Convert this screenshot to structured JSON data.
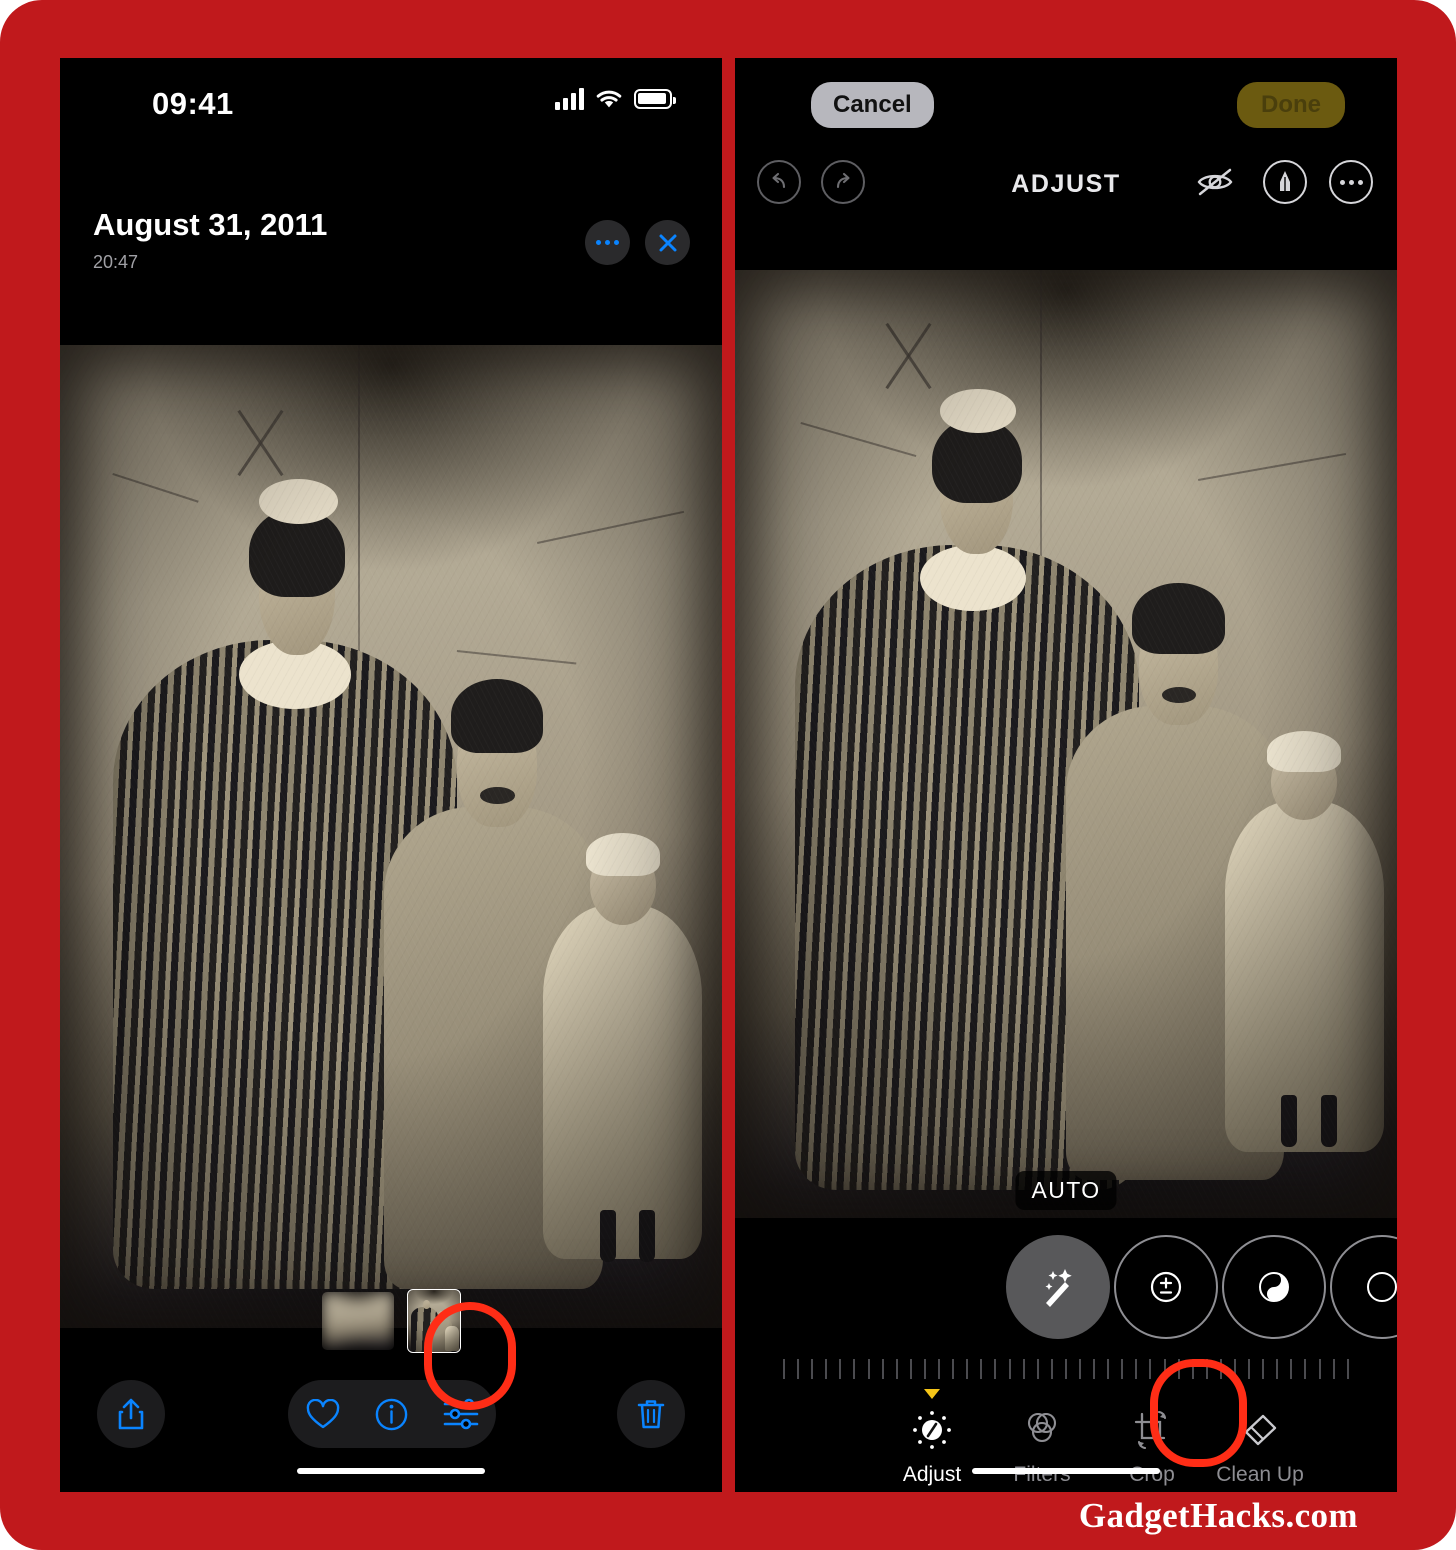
{
  "poster": {
    "background_color": "#c0191c",
    "watermark": "GadgetHacks.com"
  },
  "left_phone": {
    "status_bar": {
      "time": "09:41",
      "cellular_icon": "cellular-signal-icon",
      "wifi_icon": "wifi-icon",
      "battery_icon": "battery-full-icon"
    },
    "header": {
      "date": "August 31, 2011",
      "time": "20:47",
      "more_icon": "ellipsis-icon",
      "close_icon": "close-x-icon",
      "accent_color": "#0a84ff"
    },
    "photo": {
      "description": "Vintage sepia tintype family portrait",
      "alt": "Woman in striped dress standing beside seated man holding a small child"
    },
    "thumbnails": [
      {
        "name": "blurred-thumbnail",
        "selected": false
      },
      {
        "name": "portrait-thumbnail",
        "selected": true
      }
    ],
    "action_bar": {
      "share_label": "Share",
      "share_icon": "share-up-arrow-icon",
      "favorite_label": "Favorite",
      "favorite_icon": "heart-icon",
      "info_label": "Info",
      "info_icon": "info-circle-icon",
      "edit_label": "Edit",
      "edit_icon": "sliders-adjust-icon",
      "delete_label": "Delete",
      "delete_icon": "trash-icon"
    },
    "highlight": {
      "target": "sliders-adjust-icon",
      "color": "#ff2d16"
    }
  },
  "right_phone": {
    "top_bar": {
      "cancel_label": "Cancel",
      "done_label": "Done",
      "cancel_color": "#b7b7bd",
      "done_color": "#6b5a10"
    },
    "edit_bar": {
      "title": "ADJUST",
      "undo_icon": "undo-arrow-icon",
      "redo_icon": "redo-arrow-icon",
      "hide_icon": "eye-slash-icon",
      "markup_icon": "markup-pen-icon",
      "more_icon": "ellipsis-circle-icon"
    },
    "photo": {
      "description": "Vintage sepia tintype family portrait in editor",
      "auto_badge": "AUTO"
    },
    "adjust_tools": [
      {
        "label": "Auto",
        "icon": "magic-wand-icon",
        "selected": true
      },
      {
        "label": "Exposure",
        "icon": "exposure-plus-minus-icon",
        "selected": false
      },
      {
        "label": "Brilliance",
        "icon": "brilliance-circle-icon",
        "selected": false
      },
      {
        "label": "Highlights",
        "icon": "highlights-icon",
        "selected": false
      }
    ],
    "slider": {
      "ticks": 41,
      "value_marker": "none"
    },
    "tabs": [
      {
        "label": "Adjust",
        "icon": "adjust-dial-icon",
        "active": true
      },
      {
        "label": "Filters",
        "icon": "filters-circles-icon",
        "active": false
      },
      {
        "label": "Crop",
        "icon": "crop-rotate-icon",
        "active": false
      },
      {
        "label": "Clean Up",
        "icon": "cleanup-eraser-icon",
        "active": false
      }
    ],
    "highlight": {
      "target": "cleanup-eraser-icon",
      "color": "#ff2d16"
    }
  }
}
